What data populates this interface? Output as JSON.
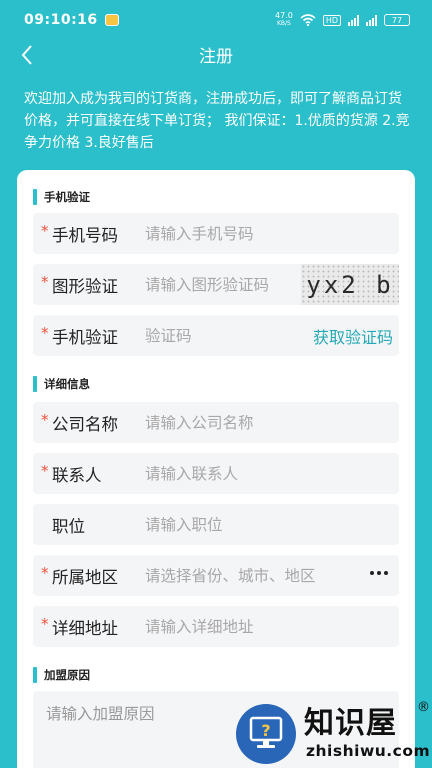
{
  "status_bar": {
    "time": "09:10:16",
    "net_speed_value": "47.0",
    "net_speed_unit": "KB/S",
    "hd_label": "HD",
    "battery": "77"
  },
  "nav": {
    "title": "注册",
    "back_icon": "chevron-left-icon"
  },
  "intro": "欢迎加入成为我司的订货商，注册成功后，即可了解商品订货 价格，并可直接在线下单订货； 我们保证：1.优质的货源 2.竞争力价格 3.良好售后",
  "sections": {
    "phone_verify": "手机验证",
    "details": "详细信息",
    "join_reason": "加盟原因"
  },
  "fields": {
    "phone": {
      "required": "*",
      "label": "手机号码",
      "placeholder": "请输入手机号码",
      "value": ""
    },
    "captcha": {
      "required": "*",
      "label": "图形验证",
      "placeholder": "请输入图形验证码",
      "value": "",
      "image_text": "yx2 b"
    },
    "sms": {
      "required": "*",
      "label": "手机验证",
      "placeholder": "验证码",
      "value": "",
      "button": "获取验证码"
    },
    "company": {
      "required": "*",
      "label": "公司名称",
      "placeholder": "请输入公司名称",
      "value": ""
    },
    "contact": {
      "required": "*",
      "label": "联系人",
      "placeholder": "请输入联系人",
      "value": ""
    },
    "position": {
      "label": "职位",
      "placeholder": "请输入职位",
      "value": ""
    },
    "region": {
      "required": "*",
      "label": "所属地区",
      "placeholder": "请选择省份、城市、地区",
      "value": ""
    },
    "address": {
      "required": "*",
      "label": "详细地址",
      "placeholder": "请输入详细地址",
      "value": ""
    },
    "reason": {
      "placeholder": "请输入加盟原因",
      "value": ""
    }
  },
  "watermark": {
    "cn": "知识屋",
    "reg": "®",
    "en": "zhishiwu.com",
    "icon": "question-monitor-icon"
  },
  "colors": {
    "accent": "#2bbfcb",
    "required": "#e8533b",
    "link": "#25a9b6",
    "field_bg": "#f4f5f7"
  }
}
